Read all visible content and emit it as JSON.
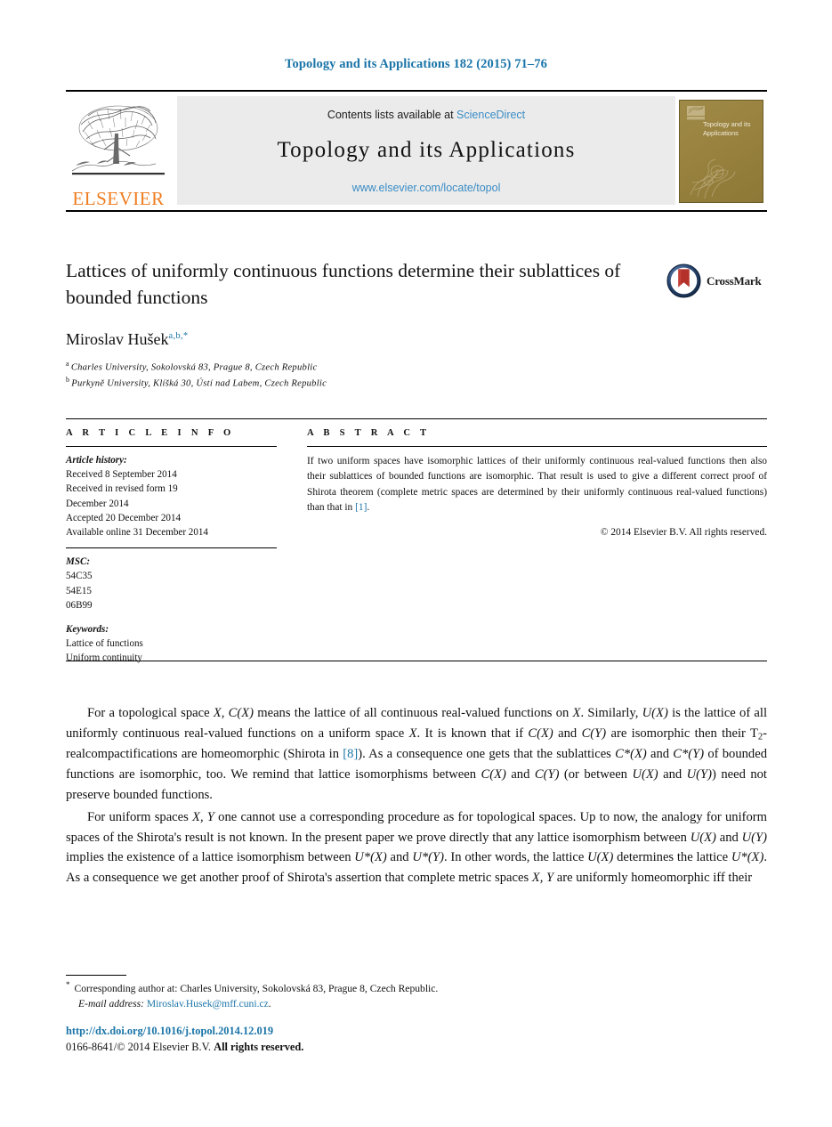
{
  "running_head": "Topology and its Applications 182 (2015) 71–76",
  "masthead": {
    "publisher_name": "ELSEVIER",
    "contents_prefix": "Contents lists available at ",
    "contents_link": "ScienceDirect",
    "journal_title": "Topology and its Applications",
    "journal_url": "www.elsevier.com/locate/topol",
    "cover_title": "Topology and its Applications"
  },
  "article": {
    "title": "Lattices of uniformly continuous functions determine their sublattices of bounded functions",
    "crossmark_label": "CrossMark",
    "author": "Miroslav Hušek",
    "author_marks": "a,b,*",
    "affiliations": [
      {
        "mark": "a",
        "text": "Charles University, Sokolovská 83, Prague 8, Czech Republic"
      },
      {
        "mark": "b",
        "text": "Purkyně University, Klíšká 30, Ústí nad Labem, Czech Republic"
      }
    ]
  },
  "info": {
    "heading": "A R T I C L E    I N F O",
    "history_label": "Article history:",
    "history": [
      "Received 8 September 2014",
      "Received in revised form 19",
      "December 2014",
      "Accepted 20 December 2014",
      "Available online 31 December 2014"
    ],
    "msc_label": "MSC:",
    "msc": [
      "54C35",
      "54E15",
      "06B99"
    ],
    "keywords_label": "Keywords:",
    "keywords": [
      "Lattice of functions",
      "Uniform continuity"
    ]
  },
  "abstract": {
    "heading": "A B S T R A C T",
    "text_before_ref": "If two uniform spaces have isomorphic lattices of their uniformly continuous real-valued functions then also their sublattices of bounded functions are isomorphic. That result is used to give a different correct proof of Shirota theorem (complete metric spaces are determined by their uniformly continuous real-valued functions) than that in ",
    "ref": "[1]",
    "text_after_ref": ".",
    "copyright": "© 2014 Elsevier B.V. All rights reserved."
  },
  "body": {
    "paragraph1": {
      "p1a": "For a topological space ",
      "m1": "X",
      "p1b": ", ",
      "m2": "C(X)",
      "p1c": " means the lattice of all continuous real-valued functions on ",
      "m3": "X",
      "p1d": ". Similarly, ",
      "m4": "U(X)",
      "p1e": " is the lattice of all uniformly continuous real-valued functions on a uniform space ",
      "m5": "X",
      "p1f": ". It is known that if ",
      "m6": "C(X)",
      "p1g": " and ",
      "m7": "C(Y)",
      "p1h": " are isomorphic then their T",
      "sub1": "2",
      "p1i": "-realcompactifications are homeomorphic (Shirota in ",
      "ref1": "[8]",
      "p1j": "). As a consequence one gets that the sublattices ",
      "m8": "C*(X)",
      "p1k": " and ",
      "m9": "C*(Y)",
      "p1l": " of bounded functions are isomorphic, too. We remind that lattice isomorphisms between ",
      "m10": "C(X)",
      "p1m": " and ",
      "m11": "C(Y)",
      "p1n": " (or between ",
      "m12": "U(X)",
      "p1o": " and ",
      "m13": "U(Y)",
      "p1p": ") need not preserve bounded functions."
    },
    "paragraph2": {
      "p2a": "For uniform spaces ",
      "m1": "X, Y",
      "p2b": " one cannot use a corresponding procedure as for topological spaces. Up to now, the analogy for uniform spaces of the Shirota's result is not known. In the present paper we prove directly that any lattice isomorphism between ",
      "m2": "U(X)",
      "p2c": " and ",
      "m3": "U(Y)",
      "p2d": " implies the existence of a lattice isomorphism between ",
      "m4": "U*(X)",
      "p2e": " and ",
      "m5": "U*(Y)",
      "p2f": ". In other words, the lattice ",
      "m6": "U(X)",
      "p2g": " determines the lattice ",
      "m7": "U*(X)",
      "p2h": ". As a consequence we get another proof of Shirota's assertion that complete metric spaces ",
      "m8": "X, Y",
      "p2i": " are uniformly homeomorphic iff their"
    }
  },
  "footnotes": {
    "corresponding": "Corresponding author at: Charles University, Sokolovská 83, Prague 8, Czech Republic.",
    "email_label": "E-mail address:",
    "email": "Miroslav.Husek@mff.cuni.cz",
    "email_period": ".",
    "doi": "http://dx.doi.org/10.1016/j.topol.2014.12.019",
    "issn_prefix": "0166-8641/© 2014 Elsevier B.V. ",
    "issn_bold": "All rights reserved."
  },
  "colors": {
    "link": "#1a74a8",
    "link_light": "#3a8cc4",
    "elsevier_orange": "#ef7d20",
    "cover_khaki": "#9c8542",
    "crossmark_blue": "#1f3f6e",
    "crossmark_red": "#b4312a"
  }
}
